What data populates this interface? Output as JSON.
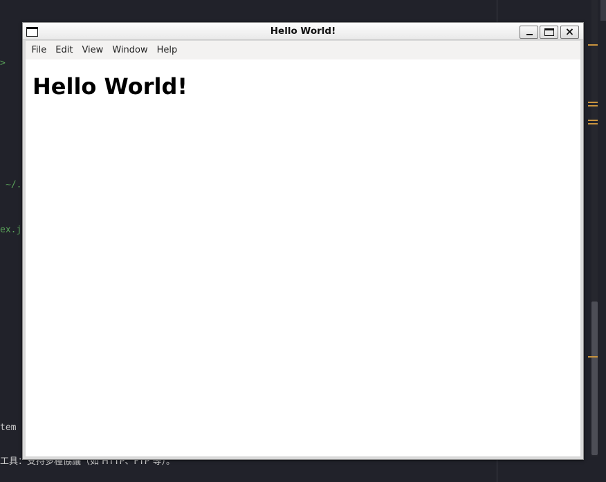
{
  "background": {
    "code_fragments": [
      ">",
      "~/.",
      "ex.j",
      "tem",
      "工具：支持多種協議（如 HTTP、FTP 等）。"
    ],
    "colors": {
      "editor_bg": "#21222a",
      "green_text": "#5aa35a",
      "plain_text": "#c8c8c8",
      "gutter_mark": "#c9943e"
    }
  },
  "window": {
    "title": "Hello World!",
    "buttons": {
      "minimize": "minimize",
      "maximize": "maximize",
      "close": "×"
    }
  },
  "menubar": {
    "items": [
      "File",
      "Edit",
      "View",
      "Window",
      "Help"
    ]
  },
  "content": {
    "heading": "Hello World!"
  }
}
